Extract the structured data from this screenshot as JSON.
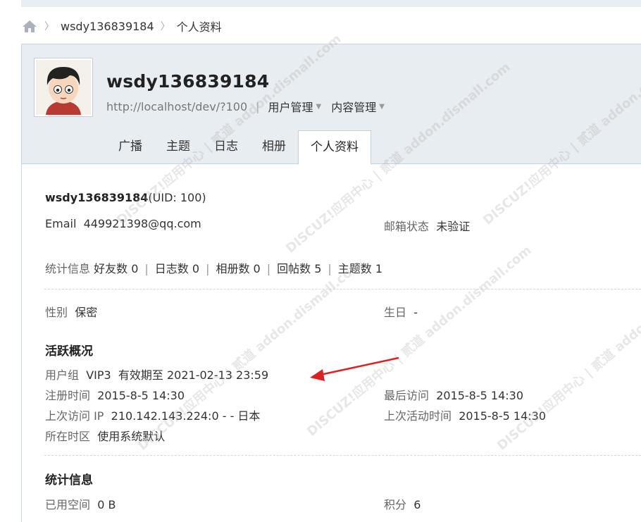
{
  "breadcrumb": {
    "items": [
      "wsdy136839184",
      "个人资料"
    ]
  },
  "profile": {
    "username": "wsdy136839184",
    "url": "http://localhost/dev/?100",
    "menus": [
      "用户管理",
      "内容管理"
    ]
  },
  "tabs": [
    "广播",
    "主题",
    "日志",
    "相册",
    "个人资料"
  ],
  "info": {
    "title_name": "wsdy136839184",
    "title_uid": "(UID: 100)",
    "email_label": "Email",
    "email_value": "449921398@qq.com",
    "email_status_label": "邮箱状态",
    "email_status_value": "未验证",
    "stats_label": "统计信息",
    "stats": [
      "好友数 0",
      "日志数 0",
      "相册数 0",
      "回帖数 5",
      "主题数 1"
    ],
    "gender_label": "性别",
    "gender_value": "保密",
    "birthday_label": "生日",
    "birthday_value": "-"
  },
  "activity": {
    "title": "活跃概况",
    "usergroup_label": "用户组",
    "usergroup_value": "VIP3",
    "expire_label": "有效期至",
    "expire_value": "2021-02-13 23:59",
    "reg_label": "注册时间",
    "reg_value": "2015-8-5 14:30",
    "last_visit_label": "最后访问",
    "last_visit_value": "2015-8-5 14:30",
    "last_ip_label": "上次访问 IP",
    "last_ip_value": "210.142.143.224:0 - - 日本",
    "last_active_label": "上次活动时间",
    "last_active_value": "2015-8-5 14:30",
    "timezone_label": "所在时区",
    "timezone_value": "使用系统默认"
  },
  "stat_section": {
    "title": "统计信息",
    "space_label": "已用空间",
    "space_value": "0 B",
    "credit_label": "积分",
    "credit_value": "6"
  },
  "watermark_text": "DISCUZ!应用中心 | 贰道 addon.dismall.com",
  "colors": {
    "header_bg": "#e8edf2",
    "arrow": "#e02020"
  }
}
